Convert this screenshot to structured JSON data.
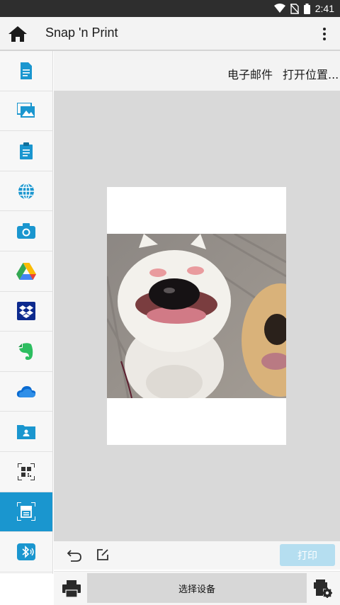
{
  "status_bar": {
    "time": "2:41"
  },
  "app_bar": {
    "title": "Snap 'n Print"
  },
  "actions": {
    "email": "电子邮件",
    "open_location": "打开位置..."
  },
  "sidebar": {
    "items": [
      {
        "icon": "document-icon"
      },
      {
        "icon": "photos-icon"
      },
      {
        "icon": "clipboard-icon"
      },
      {
        "icon": "web-icon"
      },
      {
        "icon": "camera-icon"
      },
      {
        "icon": "google-drive-icon"
      },
      {
        "icon": "dropbox-icon"
      },
      {
        "icon": "evernote-icon"
      },
      {
        "icon": "onedrive-icon"
      },
      {
        "icon": "folder-icon"
      },
      {
        "icon": "qr-code-icon"
      },
      {
        "icon": "scanner-icon",
        "active": true
      },
      {
        "icon": "bluetooth-icon"
      }
    ]
  },
  "edit_toolbar": {
    "print_label": "打印"
  },
  "device_bar": {
    "select_device_label": "选择设备"
  },
  "colors": {
    "accent": "#1a96cf",
    "print_disabled": "#b5def0",
    "preview_bg": "#d9d9d9"
  }
}
